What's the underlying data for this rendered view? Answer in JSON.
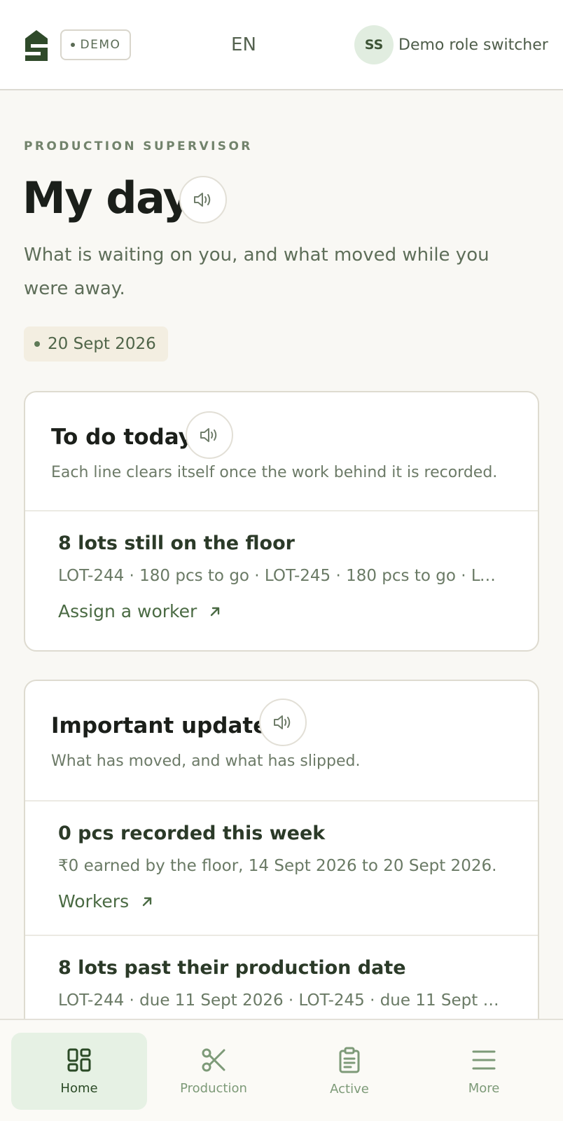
{
  "header": {
    "demo_badge": "DEMO",
    "language": "EN",
    "avatar_initials": "SS",
    "role_switcher_label": "Demo role switcher"
  },
  "page": {
    "eyebrow": "PRODUCTION SUPERVISOR",
    "title": "My day",
    "subtitle": "What is waiting on you, and what moved while you were away.",
    "date": "20 Sept 2026"
  },
  "todo": {
    "title": "To do today",
    "description": "Each line clears itself once the work behind it is recorded.",
    "items": [
      {
        "title": "8 lots still on the floor",
        "meta": "LOT-244 · 180 pcs to go · LOT-245 · 180 pcs to go · LO...",
        "link": "Assign a worker"
      }
    ]
  },
  "updates": {
    "title": "Important updates",
    "description": "What has moved, and what has slipped.",
    "items": [
      {
        "title": "0 pcs recorded this week",
        "meta": "₹0 earned by the floor, 14 Sept 2026 to 20 Sept 2026.",
        "link": "Workers"
      },
      {
        "title": "8 lots past their production date",
        "meta": "LOT-244 · due 11 Sept 2026 · LOT-245 · due 11 Sept 20..."
      }
    ]
  },
  "nav": {
    "items": [
      {
        "label": "Home",
        "icon": "grid-icon",
        "active": true
      },
      {
        "label": "Production",
        "icon": "scissors-icon"
      },
      {
        "label": "Active",
        "icon": "clipboard-icon"
      },
      {
        "label": "More",
        "icon": "menu-icon"
      }
    ]
  },
  "colors": {
    "accent": "#4a6a43",
    "background": "#f9f8f4",
    "card": "#ffffff",
    "active_nav": "#e6f1e4"
  }
}
